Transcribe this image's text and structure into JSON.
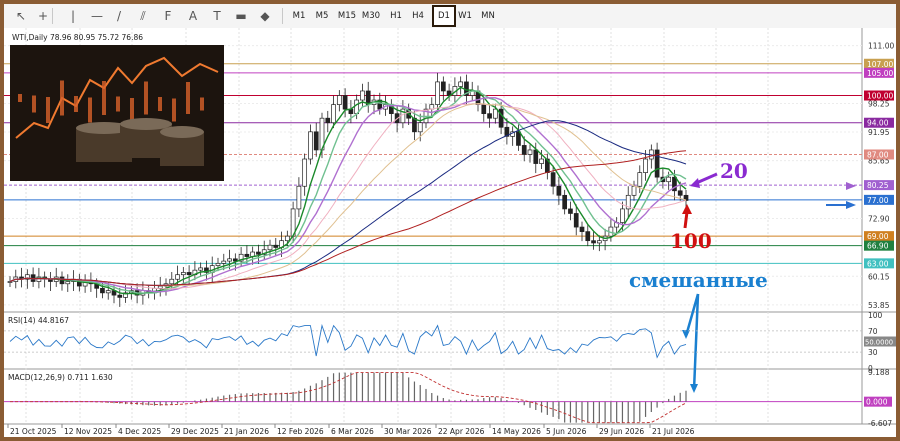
{
  "toolbar": {
    "tools": [
      "cursor-icon",
      "crosshair-icon",
      "vertical-line-icon",
      "horizontal-line-icon",
      "trendline-icon",
      "channel-icon",
      "fibonacci-icon",
      "text-icon",
      "label-icon",
      "rectangle-icon",
      "shapes-icon"
    ],
    "timeframes": [
      "M1",
      "M5",
      "M15",
      "M30",
      "H1",
      "H4",
      "D1",
      "W1",
      "MN"
    ],
    "active_timeframe": "D1"
  },
  "chart_data": {
    "type": "line",
    "symbol_header": "WTI,Daily  78.96 80.95 75.72 76.86",
    "price_axis_ticks": [
      "111.00",
      "98.25",
      "91.95",
      "85.65",
      "72.90",
      "60.15",
      "53.85"
    ],
    "price_ylim": [
      52.5,
      114
    ],
    "horizontal_levels": [
      {
        "value": 107.0,
        "label": "107.00",
        "color": "#c8a050"
      },
      {
        "value": 105.0,
        "label": "105.00",
        "color": "#c040c0"
      },
      {
        "value": 100.0,
        "label": "100.00",
        "color": "#c00030"
      },
      {
        "value": 94.0,
        "label": "94.00",
        "color": "#8a2aa0"
      },
      {
        "value": 87.0,
        "label": "87.00",
        "color": "#e08a80"
      },
      {
        "value": 80.25,
        "label": "80.25",
        "color": "#a060d0"
      },
      {
        "value": 77.0,
        "label": "77.00",
        "color": "#2a70d0"
      },
      {
        "value": 69.0,
        "label": "69.00",
        "color": "#d08020"
      },
      {
        "value": 66.9,
        "label": "66.90",
        "color": "#208040"
      },
      {
        "value": 63.0,
        "label": "63.00",
        "color": "#40c0c0"
      }
    ],
    "x_dates": [
      "21 Oct 2025",
      "12 Nov 2025",
      "4 Dec 2025",
      "29 Dec 2025",
      "21 Jan 2026",
      "12 Feb 2026",
      "6 Mar 2026",
      "30 Mar 2026",
      "22 Apr 2026",
      "14 May 2026",
      "5 Jun 2026",
      "29 Jun 2026",
      "21 Jul 2026"
    ],
    "price_series": [
      59,
      60,
      59.5,
      60.5,
      59,
      60,
      59.5,
      59,
      60,
      58.5,
      59,
      59.5,
      58,
      59,
      58.5,
      57.5,
      56.5,
      57,
      56,
      55.5,
      56.5,
      57,
      56,
      57,
      56.5,
      57.5,
      58,
      58.5,
      59.5,
      60.5,
      61,
      60.5,
      61.5,
      62,
      61,
      62.5,
      63,
      63.5,
      64,
      63.5,
      65,
      64.5,
      65.5,
      65,
      66,
      67,
      66.5,
      68,
      69,
      75,
      80,
      86,
      92,
      88,
      95,
      94,
      98,
      100,
      97,
      96,
      99,
      101,
      98,
      99,
      97,
      98,
      96,
      94,
      97,
      95,
      92,
      94,
      97,
      98,
      103,
      101,
      100,
      102,
      103,
      100,
      101,
      98,
      96,
      95,
      97,
      93,
      91,
      92,
      89,
      87,
      88,
      85,
      86,
      83,
      80,
      78,
      75,
      74,
      71,
      70,
      68,
      67.5,
      68,
      69,
      71,
      72,
      75,
      78,
      80,
      83,
      86,
      88,
      82,
      81,
      82,
      79,
      78,
      76.86
    ],
    "ma_series": [
      {
        "period": "fast",
        "color": "#1a8a2a"
      },
      {
        "period": "slow-green",
        "color": "#70c090"
      },
      {
        "period": "violet",
        "color": "#b070d0"
      },
      {
        "period": "pink",
        "color": "#f0b0c0"
      },
      {
        "period": "tan",
        "color": "#e0c090"
      },
      {
        "period": "navy",
        "color": "#1a2a80"
      },
      {
        "period": "red",
        "color": "#b02020"
      }
    ],
    "annotations": [
      {
        "text": "20",
        "color": "#8a2ad0"
      },
      {
        "text": "100",
        "color": "#d01010"
      },
      {
        "text": "смешанные",
        "color": "#1a80d0"
      }
    ],
    "rsi": {
      "label": "RSI(14) 44.8167",
      "ticks": [
        "100",
        "70",
        "50.0000",
        "30",
        "0"
      ],
      "ylim": [
        0,
        100
      ]
    },
    "macd": {
      "label": "MACD(12,26,9) 0.711 1.630",
      "ticks": [
        "9.188",
        "0.000",
        "-6.607"
      ],
      "ylim": [
        -6.607,
        9.188
      ]
    }
  }
}
